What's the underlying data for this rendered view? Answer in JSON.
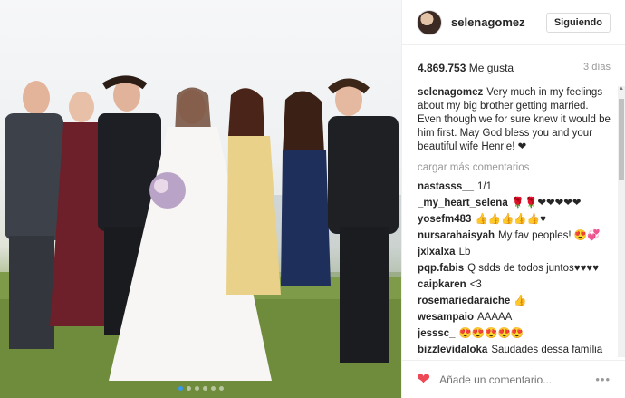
{
  "post": {
    "username": "selenagomez",
    "follow_label": "Siguiendo",
    "likes_count": "4.869.753",
    "likes_label": "Me gusta",
    "time_ago": "3 días",
    "caption": "Very much in my feelings about my big brother getting married. Even though we for sure knew it would be him first. May God bless you and your beautiful wife Henrie! ❤",
    "load_more": "cargar más comentarios",
    "comments": [
      {
        "user": "nastasss__",
        "text": "1/1"
      },
      {
        "user": "_my_heart_selena",
        "text": "🌹🌹❤❤❤❤❤"
      },
      {
        "user": "yosefm483",
        "text": "👍👍👍👍👍♥"
      },
      {
        "user": "nursarahaisyah",
        "text": "My fav peoples! 😍💞"
      },
      {
        "user": "jxlxalxa",
        "text": "Lb"
      },
      {
        "user": "pqp.fabis",
        "text": "Q sdds de todos juntos♥♥♥♥"
      },
      {
        "user": "caipkaren",
        "text": "<3"
      },
      {
        "user": "rosemariedaraiche",
        "text": "👍"
      },
      {
        "user": "wesampaio",
        "text": "AAAAA"
      },
      {
        "user": "jesssc_",
        "text": "😍😍😍😍😍"
      },
      {
        "user": "bizzlevidaloka",
        "text": "Saudades dessa família"
      }
    ],
    "comment_placeholder": "Añade un comentario...",
    "more_options": "•••"
  },
  "carousel": {
    "dot_count": 6,
    "active_dot": 0
  },
  "colors": {
    "accent_blue": "#3897f0",
    "like_red": "#ed4956"
  }
}
